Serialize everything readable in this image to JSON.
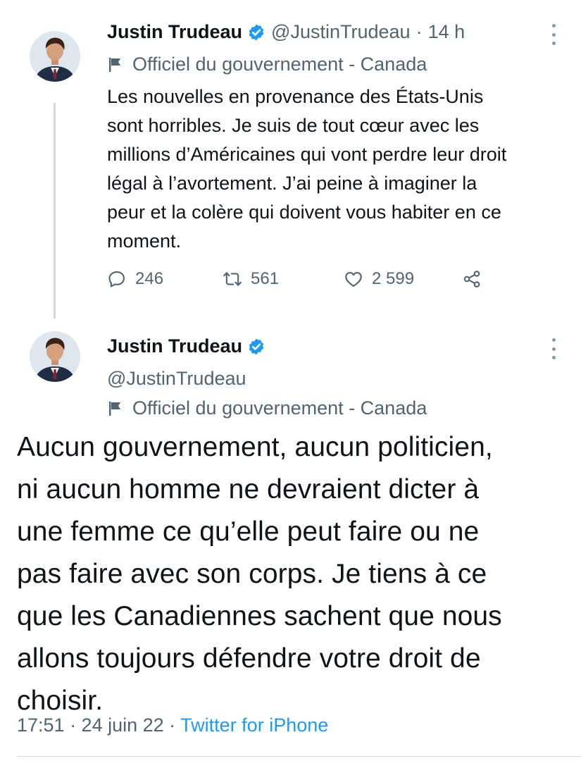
{
  "tweet1": {
    "author_name": "Justin Trudeau",
    "handle": "@JustinTrudeau",
    "separator": "·",
    "time": "14 h",
    "label": "Officiel du gouvernement - Canada",
    "text_lines": [
      "Les nouvelles en provenance des États-Unis",
      "sont horribles. Je suis de tout cœur avec les",
      "millions d’Américaines qui vont perdre leur droit",
      "légal à l’avortement. J’ai peine à imaginer la",
      "peur et la colère qui doivent vous habiter en ce",
      "moment."
    ],
    "replies": "246",
    "retweets": "561",
    "likes": "2 599"
  },
  "tweet2": {
    "author_name": "Justin Trudeau",
    "handle": "@JustinTrudeau",
    "label": "Officiel du gouvernement - Canada",
    "text_lines": [
      "Aucun gouvernement, aucun politicien,",
      "ni aucun homme ne devraient dicter à",
      "une femme ce qu’elle peut faire ou ne",
      "pas faire avec son corps. Je tiens à ce",
      "que les Canadiennes sachent que nous",
      "allons toujours défendre votre droit de",
      "choisir."
    ],
    "timestamp": "17:51 · 24 juin 22 ·",
    "source": "Twitter for iPhone"
  },
  "icons": {
    "verified": "verified-badge-icon",
    "label": "flag-icon",
    "reply": "reply-icon",
    "retweet": "retweet-icon",
    "like": "heart-icon",
    "share": "share-icon",
    "more": "more-vertical-icon"
  },
  "colors": {
    "accent": "#1d9bf0",
    "text": "#0f1419",
    "secondary": "#536471",
    "thread_line": "#cfd9de"
  }
}
